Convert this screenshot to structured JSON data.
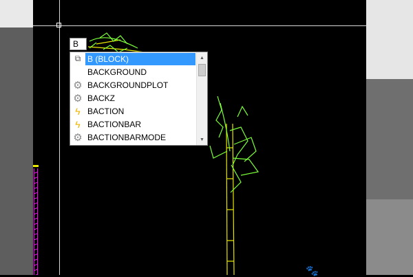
{
  "command_line": {
    "typed": "B"
  },
  "autocomplete": {
    "items": [
      {
        "label": "B (BLOCK)",
        "icon": "block-icon",
        "selected": true
      },
      {
        "label": "BACKGROUND",
        "icon": "none",
        "selected": false
      },
      {
        "label": "BACKGROUNDPLOT",
        "icon": "gear-icon",
        "selected": false
      },
      {
        "label": "BACKZ",
        "icon": "gear-icon",
        "selected": false
      },
      {
        "label": "BACTION",
        "icon": "lightning-icon",
        "selected": false
      },
      {
        "label": "BACTIONBAR",
        "icon": "lightning-icon",
        "selected": false
      },
      {
        "label": "BACTIONBARMODE",
        "icon": "gear-icon",
        "selected": false
      }
    ],
    "scroll_position": 0
  },
  "colors": {
    "canvas": "#000000",
    "plant": "#7CFF3A",
    "stem": "#E8E800",
    "selection": "#3399FF",
    "magenta": "#FF00FF"
  }
}
